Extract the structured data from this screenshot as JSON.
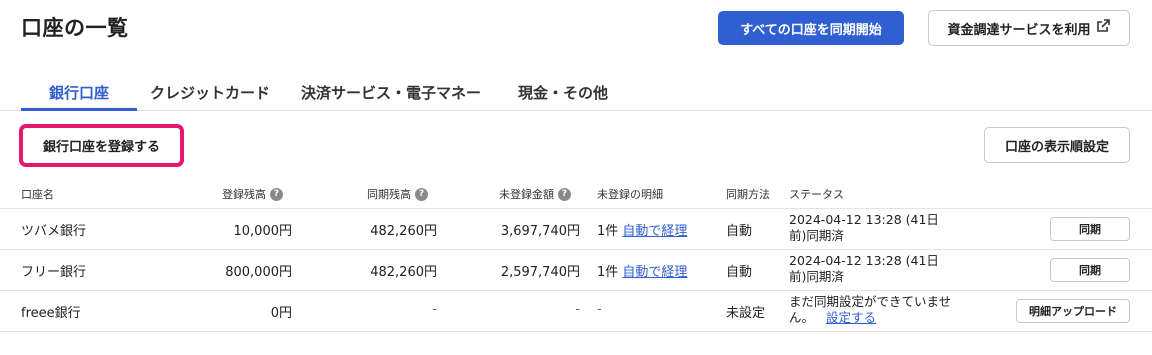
{
  "header": {
    "title": "口座の一覧",
    "sync_all_label": "すべての口座を同期開始",
    "funding_label": "資金調達サービスを利用"
  },
  "tabs": [
    {
      "label": "銀行口座",
      "active": true
    },
    {
      "label": "クレジットカード",
      "active": false
    },
    {
      "label": "決済サービス・電子マネー",
      "active": false
    },
    {
      "label": "現金・その他",
      "active": false
    }
  ],
  "actions": {
    "register_label": "銀行口座を登録する",
    "order_label": "口座の表示順設定"
  },
  "table": {
    "columns": {
      "name": "口座名",
      "registered_balance": "登録残高",
      "synced_balance": "同期残高",
      "unregistered_amount": "未登録金額",
      "unregistered_detail": "未登録の明細",
      "sync_method": "同期方法",
      "status": "ステータス"
    },
    "rows": [
      {
        "name": "ツバメ銀行",
        "registered_balance": "10,000円",
        "synced_balance": "482,260円",
        "unregistered_amount": "3,697,740円",
        "detail_count": "1件",
        "detail_link": "自動で経理",
        "sync_method": "自動",
        "status": "2024-04-12 13:28 (41日前)同期済",
        "status_link": "",
        "action": "同期"
      },
      {
        "name": "フリー銀行",
        "registered_balance": "800,000円",
        "synced_balance": "482,260円",
        "unregistered_amount": "2,597,740円",
        "detail_count": "1件",
        "detail_link": "自動で経理",
        "sync_method": "自動",
        "status": "2024-04-12 13:28 (41日前)同期済",
        "status_link": "",
        "action": "同期"
      },
      {
        "name": "freee銀行",
        "registered_balance": "0円",
        "synced_balance": "-",
        "unregistered_amount": "-",
        "detail_count": "-",
        "detail_link": "",
        "sync_method": "未設定",
        "status": "まだ同期設定ができていません。",
        "status_link": "設定する",
        "action": "明細アップロード"
      }
    ]
  },
  "icons": {
    "help": "question-circle-icon",
    "external": "external-link-icon"
  },
  "colors": {
    "primary": "#2f5fd0",
    "highlight": "#e5176e"
  }
}
